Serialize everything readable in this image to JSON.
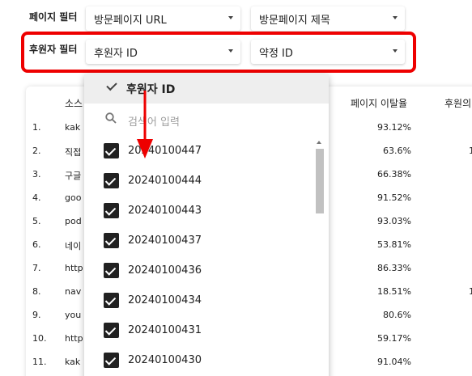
{
  "filters": {
    "page_filter_label": "페이지 필터",
    "page_url_select": "방문페이지 URL",
    "page_title_select": "방문페이지 제목",
    "sponsor_filter_label": "후원자 필터",
    "sponsor_id_select": "후원자 ID",
    "pledge_id_select": "약정 ID"
  },
  "table": {
    "col_source": "소스",
    "col_bounce": "페이지 이탈율",
    "col_sponsor": "후원의",
    "rows": [
      {
        "num": "1.",
        "source": "kak",
        "bounce": "93.12%",
        "extra": ""
      },
      {
        "num": "2.",
        "source": "직접",
        "bounce": "63.6%",
        "extra": "1"
      },
      {
        "num": "3.",
        "source": "구글",
        "bounce": "66.38%",
        "extra": ""
      },
      {
        "num": "4.",
        "source": "goo",
        "bounce": "91.52%",
        "extra": ""
      },
      {
        "num": "5.",
        "source": "pod",
        "bounce": "93.03%",
        "extra": ""
      },
      {
        "num": "6.",
        "source": "네이",
        "bounce": "53.81%",
        "extra": ""
      },
      {
        "num": "7.",
        "source": "http",
        "bounce": "86.33%",
        "extra": ""
      },
      {
        "num": "8.",
        "source": "nav",
        "bounce": "18.51%",
        "extra": "1"
      },
      {
        "num": "9.",
        "source": "you",
        "bounce": "80.6%",
        "extra": ""
      },
      {
        "num": "10.",
        "source": "http",
        "bounce": "59.17%",
        "extra": ""
      },
      {
        "num": "11.",
        "source": "kak",
        "bounce": "91.04%",
        "extra": ""
      }
    ]
  },
  "dropdown": {
    "header": "후원자 ID",
    "search_placeholder": "검색어 입력",
    "options": [
      "20240100447",
      "20240100444",
      "20240100443",
      "20240100437",
      "20240100436",
      "20240100434",
      "20240100431",
      "20240100430"
    ]
  },
  "icons": {
    "header_check": "checkmark-icon",
    "search": "search-icon",
    "caret": "caret-down-icon",
    "arrow": "down-arrow-annotation"
  },
  "colors": {
    "highlight_frame": "#ee0000",
    "checkbox": "#212121",
    "header_bg": "#eeeeee"
  }
}
